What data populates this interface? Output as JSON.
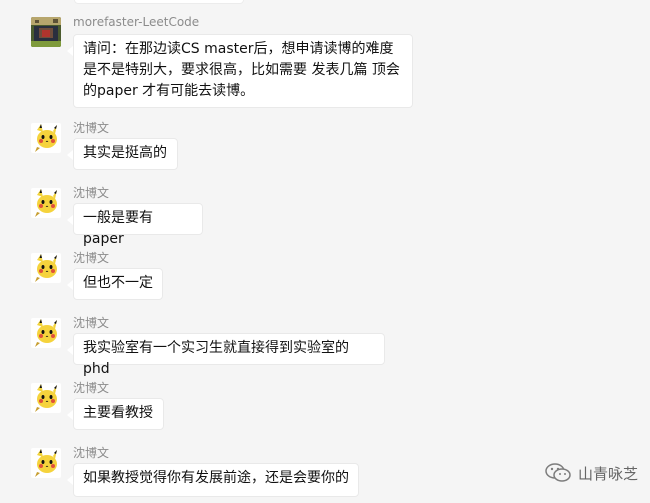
{
  "messages": [
    {
      "sender": "morefaster-LeetCode",
      "text": "请问：在那边读CS master后，想申请读博的难度是不是特别大，要求很高，比如需要 发表几篇 顶会的paper 才有可能去读博。",
      "avatar_icon": "pixel-scene-avatar"
    },
    {
      "sender": "沈博文",
      "text": "其实是挺高的",
      "avatar_icon": "pikachu-avatar"
    },
    {
      "sender": "沈博文",
      "text": "一般是要有paper",
      "avatar_icon": "pikachu-avatar"
    },
    {
      "sender": "沈博文",
      "text": "但也不一定",
      "avatar_icon": "pikachu-avatar"
    },
    {
      "sender": "沈博文",
      "text": "我实验室有一个实习生就直接得到实验室的phd",
      "avatar_icon": "pikachu-avatar"
    },
    {
      "sender": "沈博文",
      "text": "主要看教授",
      "avatar_icon": "pikachu-avatar"
    },
    {
      "sender": "沈博文",
      "text": "如果教授觉得你有发展前途，还是会要你的",
      "avatar_icon": "pikachu-avatar"
    }
  ],
  "watermark": {
    "label": "山青咏芝",
    "icon": "wechat-icon"
  },
  "colors": {
    "background": "#f5f5f5",
    "bubble": "#ffffff",
    "name_text": "#8c8c8c",
    "message_text": "#111111"
  }
}
